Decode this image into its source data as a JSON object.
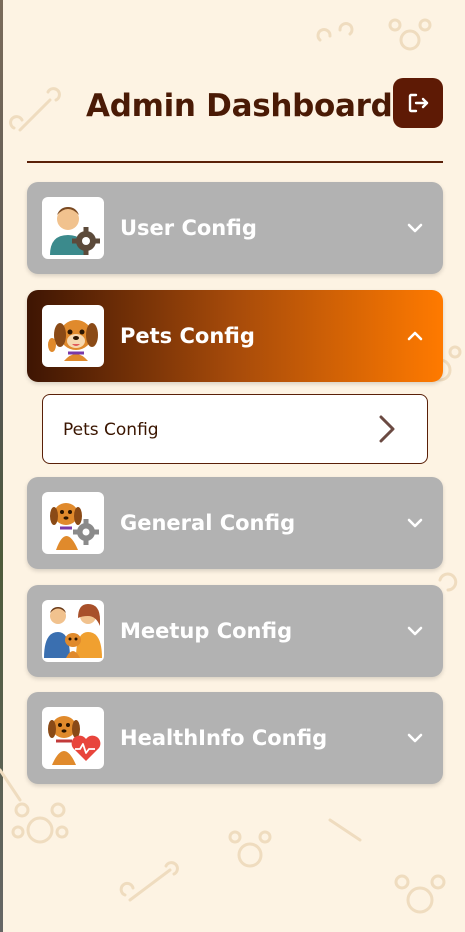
{
  "header": {
    "title": "Admin Dashboard",
    "logout_icon": "logout-icon"
  },
  "colors": {
    "brand_dark": "#5e1a05",
    "active_gradient_end": "#ff7a00",
    "card_inactive": "#b2b2b2",
    "background": "#fdf3e3"
  },
  "menu": [
    {
      "label": "User Config",
      "icon": "user-gear-icon",
      "expanded": false
    },
    {
      "label": "Pets Config",
      "icon": "waving-dog-icon",
      "expanded": true,
      "children": [
        {
          "label": "Pets Config",
          "icon": "chevron-right-icon"
        }
      ]
    },
    {
      "label": "General Config",
      "icon": "dog-gear-icon",
      "expanded": false
    },
    {
      "label": "Meetup Config",
      "icon": "people-with-dog-icon",
      "expanded": false
    },
    {
      "label": "HealthInfo Config",
      "icon": "dog-heart-icon",
      "expanded": false
    }
  ]
}
